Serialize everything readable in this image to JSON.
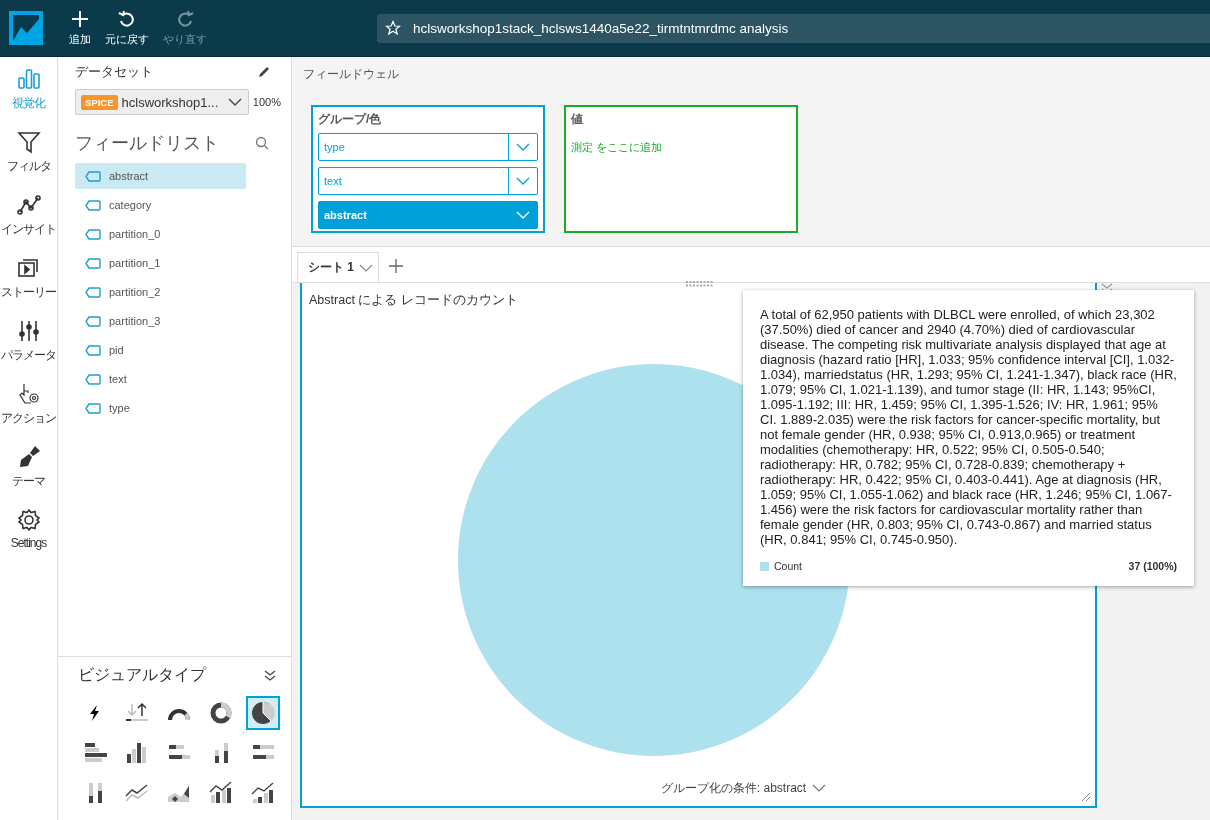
{
  "toolbar": [
    {
      "kind": "add",
      "label": "追加",
      "disabled": false
    },
    {
      "kind": "undo",
      "label": "元に戻す",
      "disabled": false
    },
    {
      "kind": "redo",
      "label": "やり直す",
      "disabled": true
    }
  ],
  "analysis_title": "hclsworkshop1stack_hclsws1440a5e22_tirmtntmrdmc analysis",
  "rail": [
    {
      "kind": "visualize",
      "label": "視覚化",
      "selected": true
    },
    {
      "kind": "filter",
      "label": "フィルタ",
      "selected": false
    },
    {
      "kind": "insight",
      "label": "インサイト",
      "selected": false
    },
    {
      "kind": "story",
      "label": "ストーリー",
      "selected": false
    },
    {
      "kind": "parameter",
      "label": "パラメータ",
      "selected": false
    },
    {
      "kind": "action",
      "label": "アクション",
      "selected": false
    },
    {
      "kind": "theme",
      "label": "テーマ",
      "selected": false
    },
    {
      "kind": "settings",
      "label": "Settings",
      "selected": false
    }
  ],
  "dataset": {
    "heading": "データセット",
    "badge": "SPICE",
    "name": "hclsworkshop1...",
    "percent": "100%"
  },
  "field_list": {
    "heading": "フィールドリスト",
    "items": [
      {
        "label": "abstract",
        "selected": true
      },
      {
        "label": "category",
        "selected": false
      },
      {
        "label": "partition_0",
        "selected": false
      },
      {
        "label": "partition_1",
        "selected": false
      },
      {
        "label": "partition_2",
        "selected": false
      },
      {
        "label": "partition_3",
        "selected": false
      },
      {
        "label": "pid",
        "selected": false
      },
      {
        "label": "text",
        "selected": false
      },
      {
        "label": "type",
        "selected": false
      }
    ]
  },
  "visual_types": {
    "heading": "ビジュアルタイプ",
    "items": [
      {
        "kind": "kpi",
        "selected": false
      },
      {
        "kind": "updown",
        "selected": false
      },
      {
        "kind": "gauge",
        "selected": false
      },
      {
        "kind": "donut",
        "selected": false
      },
      {
        "kind": "pie",
        "selected": true
      },
      {
        "kind": "hbar",
        "selected": false
      },
      {
        "kind": "vbar",
        "selected": false
      },
      {
        "kind": "hbar-stacked",
        "selected": false
      },
      {
        "kind": "vbar-stacked",
        "selected": false
      },
      {
        "kind": "hbar-full",
        "selected": false
      },
      {
        "kind": "vbar-full",
        "selected": false
      },
      {
        "kind": "line",
        "selected": false
      },
      {
        "kind": "area",
        "selected": false
      },
      {
        "kind": "combo",
        "selected": false
      },
      {
        "kind": "combo-stacked",
        "selected": false
      }
    ]
  },
  "field_wells": {
    "heading": "フィールドウェル",
    "group": {
      "label": "グループ/色",
      "fields": [
        {
          "label": "type",
          "selected": false
        },
        {
          "label": "text",
          "selected": false
        },
        {
          "label": "abstract",
          "selected": true
        }
      ]
    },
    "value": {
      "label": "値",
      "placeholder": "測定 をここに追加"
    }
  },
  "sheets": [
    {
      "label": "シート 1",
      "selected": true
    }
  ],
  "visual": {
    "title": "Abstract による レコードのカウント",
    "group_by": "グループ化の条件: abstract"
  },
  "tooltip": {
    "text": "A total of 62,950 patients with DLBCL were enrolled, of which 23,302 (37.50%) died of cancer and 2940 (4.70%) died of cardiovascular disease. The competing risk multivariate analysis displayed that age at diagnosis (hazard ratio [HR], 1.033; 95% confidence interval [CI], 1.032-1.034), marriedstatus (HR, 1.293; 95% CI, 1.241-1.347), black race (HR, 1.079; 95% CI, 1.021-1.139), and tumor stage (II: HR, 1.143; 95%CI, 1.095-1.192; III: HR, 1.459; 95% CI, 1.395-1.526; IV: HR, 1.961; 95% CI. 1.889-2.035) were the risk factors for cancer-specific mortality, but not female gender (HR, 0.938; 95% CI, 0.913,0.965) or treatment modalities (chemotherapy: HR, 0.522; 95% CI, 0.505-0.540; radiotherapy: HR, 0.782; 95% CI, 0.728-0.839; chemotherapy + radiotherapy: HR, 0.422; 95% CI, 0.403-0.441). Age at diagnosis (HR, 1.059; 95% CI, 1.055-1.062) and black race (HR, 1.246; 95% CI, 1.067-1.456) were the risk factors for cardiovascular mortality rather than female gender (HR, 0.803; 95% CI, 0.743-0.867) and married status (HR, 0.841; 95% CI, 0.745-0.950).",
    "legend_label": "Count",
    "color": "#aee1ee",
    "value": "37 (100%)"
  }
}
